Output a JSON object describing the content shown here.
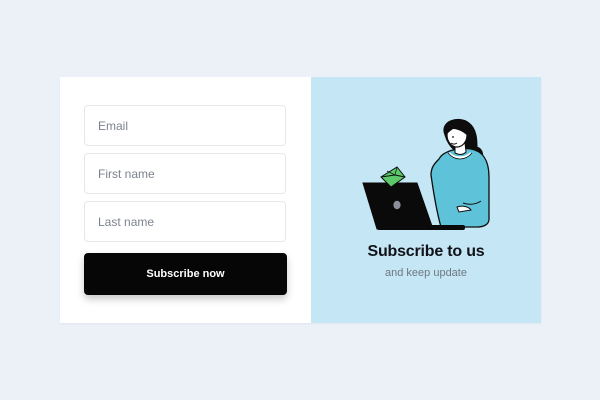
{
  "form": {
    "email": {
      "placeholder": "Email",
      "value": ""
    },
    "first_name": {
      "placeholder": "First name",
      "value": ""
    },
    "last_name": {
      "placeholder": "Last name",
      "value": ""
    },
    "submit_label": "Subscribe now"
  },
  "promo": {
    "title": "Subscribe to us",
    "subtitle": "and keep update",
    "illustration_icon": "woman-with-laptop-and-envelope"
  },
  "colors": {
    "page_background": "#ecf1f8",
    "form_background": "#ffffff",
    "promo_background": "#c4e6f5",
    "button_background": "#060606",
    "button_text": "#ffffff",
    "sweater": "#5ec2d8",
    "envelope": "#5cc96a"
  }
}
